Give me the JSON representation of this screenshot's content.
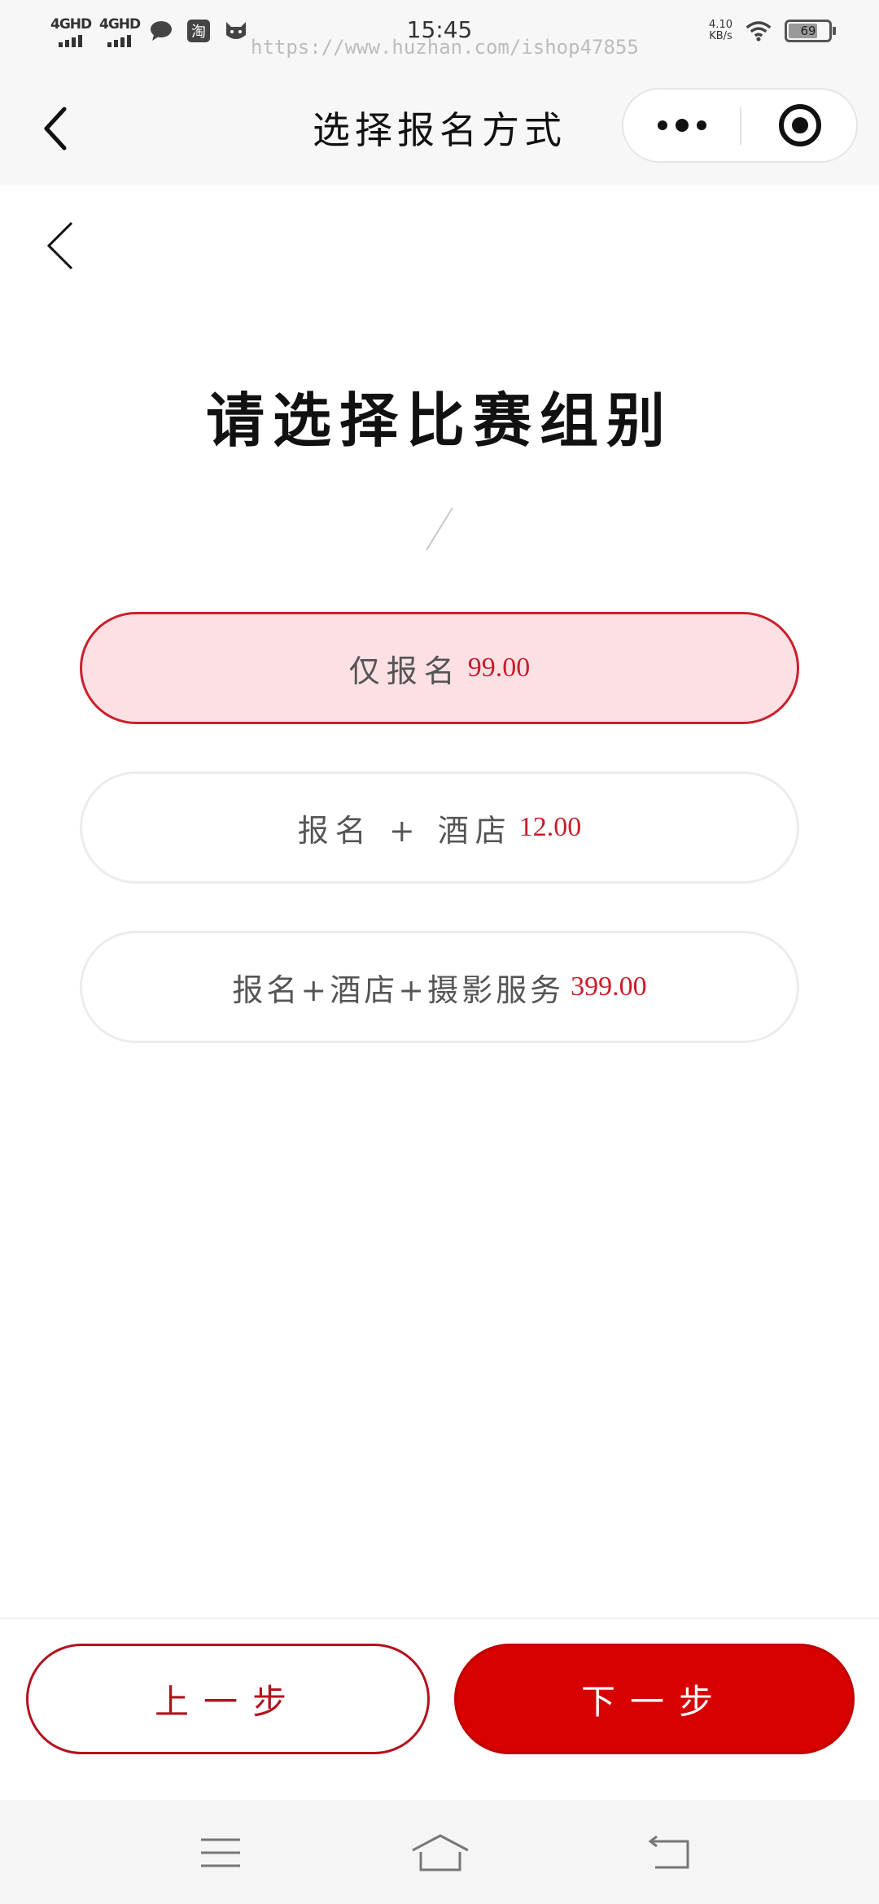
{
  "status_bar": {
    "time": "15:45",
    "signal_1_label": "4GHD",
    "signal_2_label": "4GHD",
    "net_speed_value": "4.10",
    "net_speed_unit": "KB/s",
    "battery_percent": "69",
    "watermark": "https://www.huzhan.com/ishop47855",
    "icons": [
      "signal-icon",
      "signal-icon",
      "chat-bubble-icon",
      "taobao-icon",
      "cat-app-icon",
      "wifi-icon",
      "battery-icon"
    ]
  },
  "nav_bar": {
    "title": "选择报名方式",
    "back_icon": "chevron-left-icon",
    "more_icon": "more-dots-icon",
    "close_icon": "target-circle-icon"
  },
  "page": {
    "back_icon": "chevron-left-icon",
    "heading": "请选择比赛组别",
    "options": [
      {
        "label": "仅报名",
        "price": "99.00",
        "selected": true
      },
      {
        "label": "报名 + 酒店",
        "price": "12.00",
        "selected": false
      },
      {
        "label": "报名+酒店+摄影服务",
        "price": "399.00",
        "selected": false
      }
    ]
  },
  "footer": {
    "prev_label": "上一步",
    "next_label": "下一步"
  },
  "system_nav": {
    "icons": [
      "menu-icon",
      "home-icon",
      "back-icon"
    ]
  },
  "colors": {
    "accent": "#d80000",
    "price": "#c81e2a",
    "selected_bg": "#fde0e4",
    "selected_border": "#cc1f2c"
  }
}
